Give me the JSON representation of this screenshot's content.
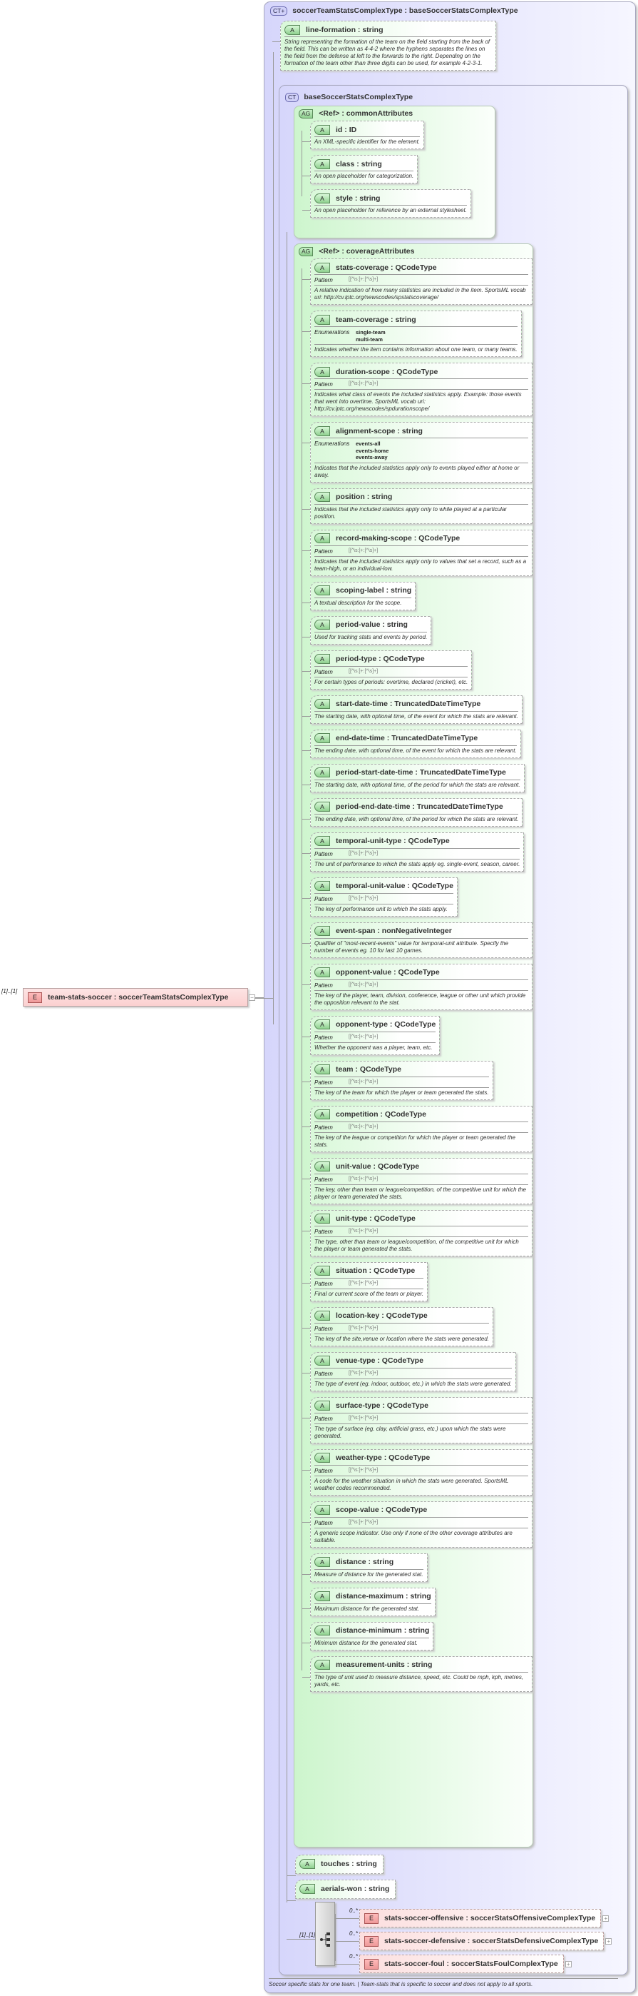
{
  "root_element": {
    "occurrence": "[1]..[1]",
    "name": "team-stats-soccer",
    "type": "soccerTeamStatsComplexType",
    "badge": "E",
    "collapse": "−"
  },
  "complex_type": {
    "badge": "CT+",
    "title": "soccerTeamStatsComplexType : baseSoccerStatsComplexType",
    "line_formation": {
      "name": "line-formation",
      "type": "string",
      "description": "String representing the formation of the team on the field starting from the back of the field. This can be written as 4-4-2 where the hyphens separates the lines on the field from the defense at left to the forwards to the right. Depending on the formation of the team other than three digits can be used, for example 4-2-3-1."
    },
    "footer": "Soccer specific stats for one team. | Team-stats that is specific to        soccer and does not apply to all sports."
  },
  "base_type": {
    "badge": "CT",
    "title": "baseSoccerStatsComplexType"
  },
  "labels": {
    "attr_badge": "A",
    "ag_badge": "AG",
    "pattern": "Pattern",
    "enumerations": "Enumerations"
  },
  "common_attributes": {
    "title": "<Ref>     : commonAttributes",
    "attributes": [
      {
        "name": "id",
        "type": "ID",
        "description": "An XML-specific identifier for the element."
      },
      {
        "name": "class",
        "type": "string",
        "description": "An open placeholder for categorization."
      },
      {
        "name": "style",
        "type": "string",
        "description": "An open placeholder for reference by an external stylesheet."
      }
    ]
  },
  "coverage_attributes": {
    "title": "<Ref>     : coverageAttributes",
    "attributes": [
      {
        "name": "stats-coverage",
        "type": "QCodeType",
        "pattern": "[[^\\s:]+:[^\\s]+]",
        "description": "A relative indication of how many statistics are included in the item. SportsML vocab uri: http://cv.iptc.org/newscodes/spstatscoverage/"
      },
      {
        "name": "team-coverage",
        "type": "string",
        "enumerations": [
          "single-team",
          "multi-team"
        ],
        "description": "Indicates whether the item contains information about one team, or many teams."
      },
      {
        "name": "duration-scope",
        "type": "QCodeType",
        "pattern": "[[^\\s:]+:[^\\s]+]",
        "description": "Indicates what class of events the included statistics apply. Example: those events that went into overtime. SportsML vocab uri: http://cv.iptc.org/newscodes/spdurationscope/"
      },
      {
        "name": "alignment-scope",
        "type": "string",
        "enumerations": [
          "events-all",
          "events-home",
          "events-away"
        ],
        "description": "Indicates that the included statistics apply only to events played either at home or away."
      },
      {
        "name": "position",
        "type": "string",
        "description": "Indicates that the included statistics apply only to while played at a particular position."
      },
      {
        "name": "record-making-scope",
        "type": "QCodeType",
        "pattern": "[[^\\s:]+:[^\\s]+]",
        "description": "Indicates that the included statistics apply only to values that set a record, such as a team-high, or an individual-low."
      },
      {
        "name": "scoping-label",
        "type": "string",
        "description": "A textual description for the scope."
      },
      {
        "name": "period-value",
        "type": "string",
        "description": "Used for tracking stats and events by period."
      },
      {
        "name": "period-type",
        "type": "QCodeType",
        "pattern": "[[^\\s:]+:[^\\s]+]",
        "description": "For certain types of periods: overtime, declared (cricket), etc."
      },
      {
        "name": "start-date-time",
        "type": "TruncatedDateTimeType",
        "description": "The starting date, with optional time, of the event for which the stats are relevant."
      },
      {
        "name": "end-date-time",
        "type": "TruncatedDateTimeType",
        "description": "The ending date, with optional time, of the event for which the stats are relevant."
      },
      {
        "name": "period-start-date-time",
        "type": "TruncatedDateTimeType",
        "description": "The starting date, with optional time, of the period for which the stats are relevant."
      },
      {
        "name": "period-end-date-time",
        "type": "TruncatedDateTimeType",
        "description": "The ending date, with optional time, of the period for which the stats are relevant."
      },
      {
        "name": "temporal-unit-type",
        "type": "QCodeType",
        "pattern": "[[^\\s:]+:[^\\s]+]",
        "description": "The unit of performance to which the stats apply eg. single-event, season, career."
      },
      {
        "name": "temporal-unit-value",
        "type": "QCodeType",
        "pattern": "[[^\\s:]+:[^\\s]+]",
        "description": "The key of performance unit to which the stats apply."
      },
      {
        "name": "event-span",
        "type": "nonNegativeInteger",
        "description": "Qualifier of \"most-recent-events\" value for temporal-unit attribute. Specify the number of events eg. 10 for last 10 games."
      },
      {
        "name": "opponent-value",
        "type": "QCodeType",
        "pattern": "[[^\\s:]+:[^\\s]+]",
        "description": "The key of the player, team, division, conference, league or other unit which provide the opposition relevant to the stat."
      },
      {
        "name": "opponent-type",
        "type": "QCodeType",
        "pattern": "[[^\\s:]+:[^\\s]+]",
        "description": "Whether the opponent was a player, team, etc."
      },
      {
        "name": "team",
        "type": "QCodeType",
        "pattern": "[[^\\s:]+:[^\\s]+]",
        "description": "The key of the team for which the player or team generated the stats."
      },
      {
        "name": "competition",
        "type": "QCodeType",
        "pattern": "[[^\\s:]+:[^\\s]+]",
        "description": "The key of the league or competition for which the player or team generated the stats."
      },
      {
        "name": "unit-value",
        "type": "QCodeType",
        "pattern": "[[^\\s:]+:[^\\s]+]",
        "description": "The key, other than team or league/competition, of the competitive unit for which the player or team generated the stats."
      },
      {
        "name": "unit-type",
        "type": "QCodeType",
        "pattern": "[[^\\s:]+:[^\\s]+]",
        "description": "The type, other than team or league/competition, of the competitive unit for which the player or team generated the stats."
      },
      {
        "name": "situation",
        "type": "QCodeType",
        "pattern": "[[^\\s:]+:[^\\s]+]",
        "description": "Final or current score of the team or player."
      },
      {
        "name": "location-key",
        "type": "QCodeType",
        "pattern": "[[^\\s:]+:[^\\s]+]",
        "description": "The key of the site,venue or location where the stats were generated."
      },
      {
        "name": "venue-type",
        "type": "QCodeType",
        "pattern": "[[^\\s:]+:[^\\s]+]",
        "description": "The type of event (eg. indoor, outdoor, etc.) in which the stats were generated."
      },
      {
        "name": "surface-type",
        "type": "QCodeType",
        "pattern": "[[^\\s:]+:[^\\s]+]",
        "description": "The type of surface (eg. clay, artificial grass, etc.) upon which the stats were generated."
      },
      {
        "name": "weather-type",
        "type": "QCodeType",
        "pattern": "[[^\\s:]+:[^\\s]+]",
        "description": "A code for the weather situation in which the stats were generated. SportsML weather codes recommended."
      },
      {
        "name": "scope-value",
        "type": "QCodeType",
        "pattern": "[[^\\s:]+:[^\\s]+]",
        "description": "A generic scope indicator. Use only if none of the other coverage attributes are suitable."
      },
      {
        "name": "distance",
        "type": "string",
        "description": "Measure of distance for the generated stat."
      },
      {
        "name": "distance-maximum",
        "type": "string",
        "description": "Maximum distance for the generated stat."
      },
      {
        "name": "distance-minimum",
        "type": "string",
        "description": "Minimum distance for the generated stat."
      },
      {
        "name": "measurement-units",
        "type": "string",
        "description": "The type of unit used to measure distance, speed, etc. Could be mph, kph, metres, yards, etc."
      }
    ]
  },
  "extra_attributes": [
    {
      "name": "touches",
      "type": "string"
    },
    {
      "name": "aerials-won",
      "type": "string"
    }
  ],
  "sequence": {
    "occurrence": "[1]..[1]",
    "elements": [
      {
        "occurrence": "0..*",
        "name": "stats-soccer-offensive",
        "type": "soccerStatsOffensiveComplexType",
        "expand": "+"
      },
      {
        "occurrence": "0..*",
        "name": "stats-soccer-defensive",
        "type": "soccerStatsDefensiveComplexType",
        "expand": "+"
      },
      {
        "occurrence": "0..*",
        "name": "stats-soccer-foul",
        "type": "soccerStatsFoulComplexType",
        "expand": "+"
      }
    ]
  }
}
